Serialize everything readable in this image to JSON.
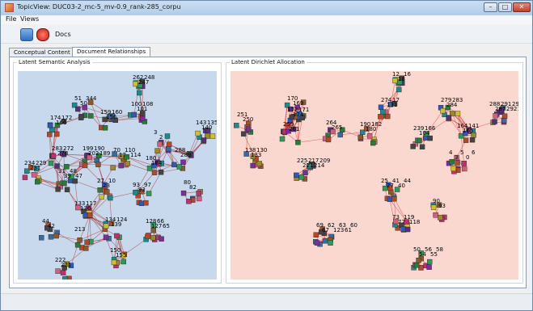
{
  "window": {
    "title": "TopicView: DUC03-2_mc-5_mv-0.9_rank-285_corpu"
  },
  "window_controls": {
    "minimize": "–",
    "maximize": "□",
    "close": "✕"
  },
  "menu": [
    "File",
    "Views"
  ],
  "toolbar": {
    "docs_label": "Docs",
    "icons": [
      "open-folder-icon",
      "power-icon"
    ]
  },
  "tabs": [
    {
      "label": "Conceptual Content",
      "active": false
    },
    {
      "label": "Document Relationships",
      "active": true
    }
  ],
  "panels": {
    "lsa": {
      "title": "Latent Semantic Analysis",
      "bg": "#c8d9ee",
      "clusters": [
        [
          "262",
          "247",
          "248"
        ],
        [
          "51",
          "50",
          "344"
        ],
        [
          "100",
          "101",
          "108"
        ],
        [
          "159",
          "156",
          "160"
        ],
        [
          "174",
          "166",
          "172"
        ],
        [
          "143",
          "140",
          "135"
        ],
        [
          "3",
          "2"
        ],
        [
          "283",
          "278",
          "272"
        ],
        [
          "199",
          "202",
          "190",
          "189"
        ],
        [
          "70",
          "17",
          "110",
          "114"
        ],
        [
          "288",
          "289"
        ],
        [
          "234",
          "231",
          "229"
        ],
        [
          "31",
          "39",
          "48",
          "47"
        ],
        [
          "180",
          "184"
        ],
        [
          "80",
          "82"
        ],
        [
          "27",
          "23",
          "10"
        ],
        [
          "93",
          "92",
          "97"
        ],
        [
          "133",
          "136",
          "117"
        ],
        [
          "44",
          "42"
        ],
        [
          "134",
          "139",
          "124"
        ],
        [
          "128",
          "127",
          "66",
          "65"
        ],
        [
          "213"
        ],
        [
          "150",
          "155"
        ],
        [
          "222",
          "221"
        ]
      ]
    },
    "lda": {
      "title": "Latent Dirichlet Allocation",
      "bg": "#fbd8cf",
      "clusters": [
        [
          "12",
          "18",
          "16"
        ],
        [
          "170",
          "169"
        ],
        [
          "251",
          "250"
        ],
        [
          "172",
          "174",
          "171"
        ],
        [
          "274",
          "131",
          "17"
        ],
        [
          "279",
          "284",
          "283"
        ],
        [
          "288",
          "287",
          "291",
          "292",
          "294",
          "295"
        ],
        [
          "259",
          "261"
        ],
        [
          "264",
          "265"
        ],
        [
          "138",
          "133",
          "130"
        ],
        [
          "225",
          "221",
          "217",
          "214",
          "209"
        ],
        [
          "190",
          "180",
          "182"
        ],
        [
          "239",
          "104",
          "166"
        ],
        [
          "164",
          "165",
          "141"
        ],
        [
          "4",
          "3",
          "5",
          "0",
          "6"
        ],
        [
          "25",
          "27",
          "41",
          "40",
          "44"
        ],
        [
          "73",
          "77",
          "119",
          "118"
        ],
        [
          "69",
          "67",
          "62",
          "123",
          "63",
          "61",
          "60"
        ],
        [
          "90",
          "93"
        ],
        [
          "50",
          "54",
          "56",
          "55",
          "58"
        ]
      ]
    }
  }
}
